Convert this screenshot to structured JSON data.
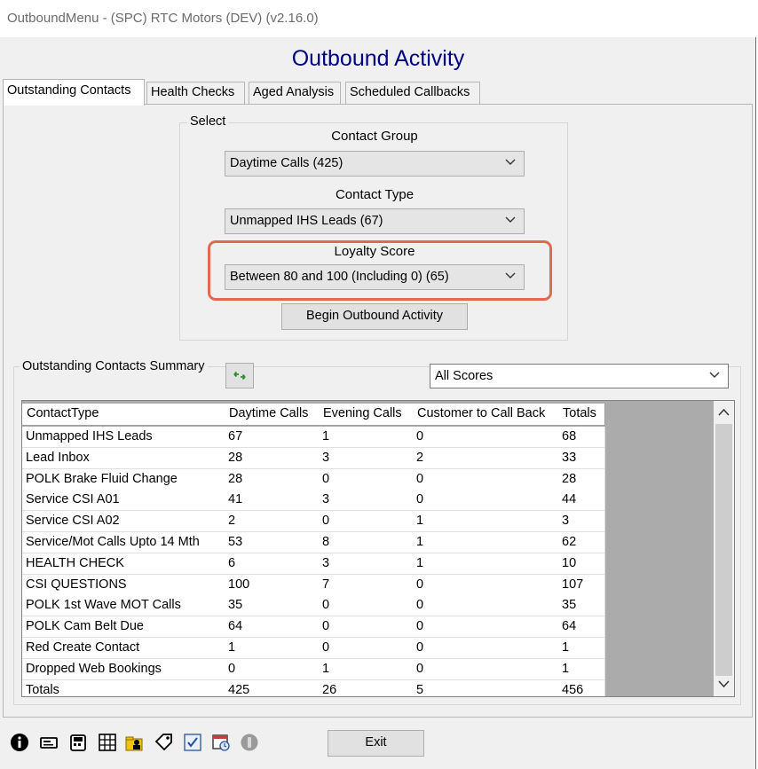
{
  "window": {
    "title": "OutboundMenu - (SPC) RTC Motors (DEV) (v2.16.0)"
  },
  "heading": "Outbound Activity",
  "tabs": [
    {
      "label": "Outstanding Contacts",
      "active": true
    },
    {
      "label": "Health Checks",
      "active": false
    },
    {
      "label": "Aged Analysis",
      "active": false
    },
    {
      "label": "Scheduled Callbacks",
      "active": false
    }
  ],
  "select_group": {
    "legend": "Select",
    "contact_group": {
      "label": "Contact Group",
      "value": "Daytime Calls (425)"
    },
    "contact_type": {
      "label": "Contact Type",
      "value": "Unmapped IHS Leads (67)"
    },
    "loyalty_score": {
      "label": "Loyalty Score",
      "value": "Between 80 and 100 (Including 0) (65)"
    },
    "begin_button": "Begin Outbound Activity"
  },
  "summary": {
    "legend": "Outstanding Contacts Summary",
    "filter_value": "All Scores",
    "columns": [
      "ContactType",
      "Daytime Calls",
      "Evening Calls",
      "Customer to Call Back",
      "Totals"
    ],
    "rows": [
      [
        "Unmapped IHS Leads",
        "67",
        "1",
        "0",
        "68"
      ],
      [
        "Lead Inbox",
        "28",
        "3",
        "2",
        "33"
      ],
      [
        "POLK Brake Fluid Change",
        "28",
        "0",
        "0",
        "28"
      ],
      [
        "Service CSI A01",
        "41",
        "3",
        "0",
        "44"
      ],
      [
        "Service CSI A02",
        "2",
        "0",
        "1",
        "3"
      ],
      [
        "Service/Mot Calls Upto 14 Mth",
        "53",
        "8",
        "1",
        "62"
      ],
      [
        "HEALTH CHECK",
        "6",
        "3",
        "1",
        "10"
      ],
      [
        "CSI QUESTIONS",
        "100",
        "7",
        "0",
        "107"
      ],
      [
        "POLK 1st Wave MOT Calls",
        "35",
        "0",
        "0",
        "35"
      ],
      [
        "POLK Cam Belt Due",
        "64",
        "0",
        "0",
        "64"
      ],
      [
        "Red Create Contact",
        "1",
        "0",
        "0",
        "1"
      ],
      [
        "Dropped Web Bookings",
        "0",
        "1",
        "0",
        "1"
      ],
      [
        "Totals",
        "425",
        "26",
        "5",
        "456"
      ]
    ]
  },
  "toolbar": {
    "icons": [
      "info-icon",
      "card-reader-icon",
      "phone-icon",
      "grid-calculator-icon",
      "folder-user-icon",
      "tag-icon",
      "checklist-icon",
      "calendar-clock-icon",
      "power-icon"
    ],
    "exit_button": "Exit"
  },
  "colors": {
    "heading": "#000080",
    "highlight": "#e06a50",
    "refresh": "#2e8b2e"
  }
}
